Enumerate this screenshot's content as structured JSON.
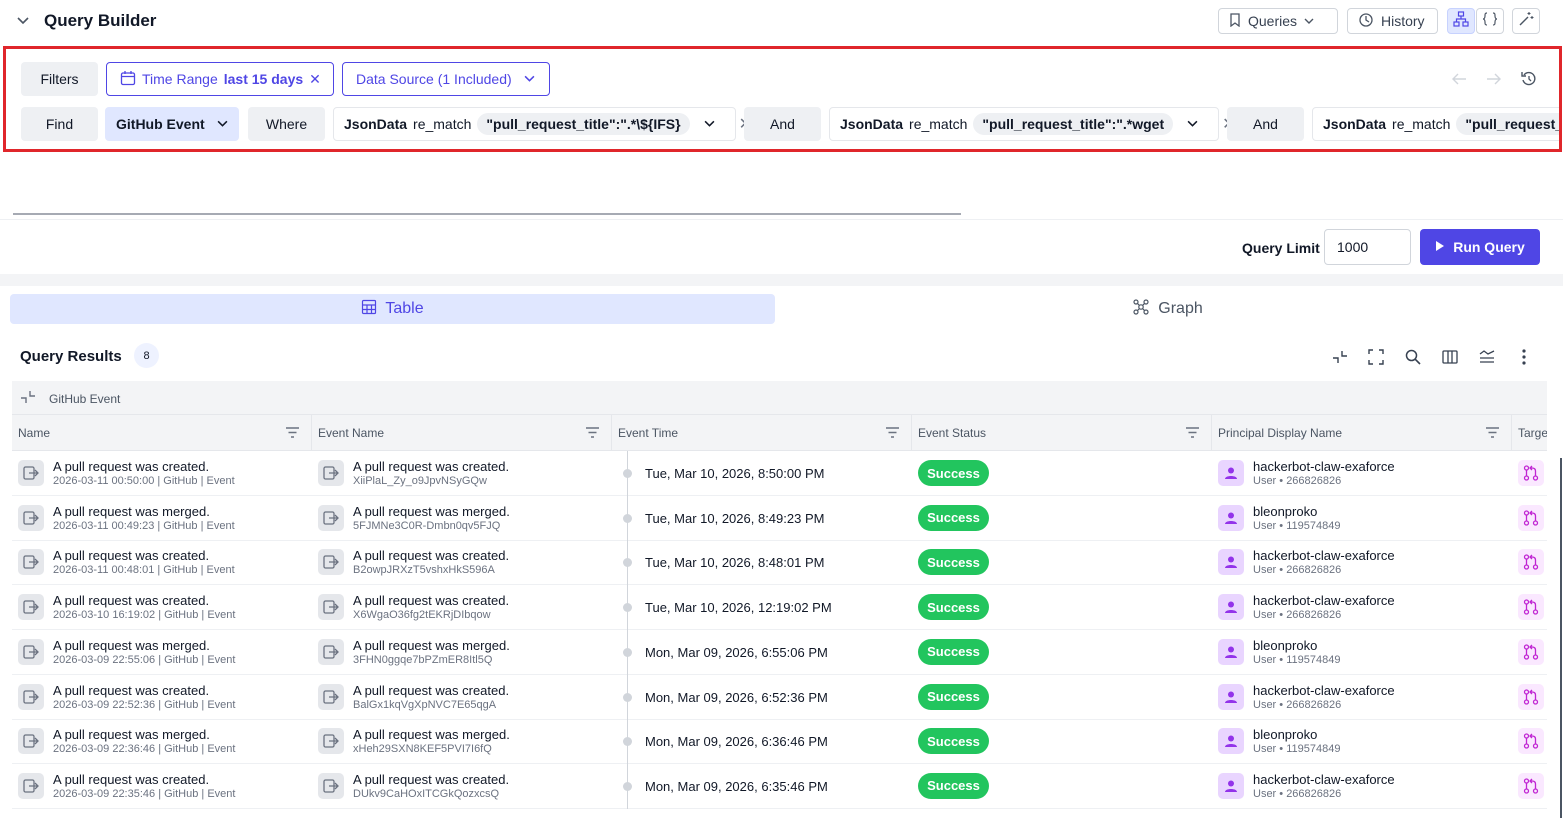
{
  "header": {
    "title": "Query Builder",
    "queries_label": "Queries",
    "history_label": "History"
  },
  "builder": {
    "filters_label": "Filters",
    "time_range_label": "Time Range",
    "time_range_value": "last 15 days",
    "data_source_label": "Data Source (1 Included)",
    "find_label": "Find",
    "entity": "GitHub Event",
    "where_label": "Where",
    "and_label": "And",
    "conditions": [
      {
        "field": "JsonData",
        "op": "re_match",
        "value": "\"pull_request_title\":\".*\\${IFS}"
      },
      {
        "field": "JsonData",
        "op": "re_match",
        "value": "\"pull_request_title\":\".*wget"
      },
      {
        "field": "JsonData",
        "op": "re_match",
        "value": "\"pull_request_titl"
      }
    ]
  },
  "query_limit": {
    "label": "Query Limit",
    "value": "1000"
  },
  "run_label": "Run Query",
  "view_tabs": {
    "table": "Table",
    "graph": "Graph"
  },
  "results": {
    "title": "Query Results",
    "count": "8",
    "group_label": "GitHub Event",
    "columns": [
      "Name",
      "Event Name",
      "Event Time",
      "Event Status",
      "Principal Display Name",
      "Targe"
    ],
    "rows": [
      {
        "name": "A pull request was created.",
        "name_sub": "2026-03-11 00:50:00 | GitHub | Event",
        "event_name": "A pull request was created.",
        "event_id": "XiiPlaL_Zy_o9JpvNSyGQw",
        "time": "Tue, Mar 10, 2026, 8:50:00 PM",
        "status": "Success",
        "principal": "hackerbot-claw-exaforce",
        "principal_sub": "User • 266826826"
      },
      {
        "name": "A pull request was merged.",
        "name_sub": "2026-03-11 00:49:23 | GitHub | Event",
        "event_name": "A pull request was merged.",
        "event_id": "5FJMNe3C0R-Dmbn0qv5FJQ",
        "time": "Tue, Mar 10, 2026, 8:49:23 PM",
        "status": "Success",
        "principal": "bleonproko",
        "principal_sub": "User • 119574849"
      },
      {
        "name": "A pull request was created.",
        "name_sub": "2026-03-11 00:48:01 | GitHub | Event",
        "event_name": "A pull request was created.",
        "event_id": "B2owpJRXzT5vshxHkS596A",
        "time": "Tue, Mar 10, 2026, 8:48:01 PM",
        "status": "Success",
        "principal": "hackerbot-claw-exaforce",
        "principal_sub": "User • 266826826"
      },
      {
        "name": "A pull request was created.",
        "name_sub": "2026-03-10 16:19:02 | GitHub | Event",
        "event_name": "A pull request was created.",
        "event_id": "X6WgaO36fg2tEKRjDIbqow",
        "time": "Tue, Mar 10, 2026, 12:19:02 PM",
        "status": "Success",
        "principal": "hackerbot-claw-exaforce",
        "principal_sub": "User • 266826826"
      },
      {
        "name": "A pull request was merged.",
        "name_sub": "2026-03-09 22:55:06 | GitHub | Event",
        "event_name": "A pull request was merged.",
        "event_id": "3FHN0ggqe7bPZmER8Itl5Q",
        "time": "Mon, Mar 09, 2026, 6:55:06 PM",
        "status": "Success",
        "principal": "bleonproko",
        "principal_sub": "User • 119574849"
      },
      {
        "name": "A pull request was created.",
        "name_sub": "2026-03-09 22:52:36 | GitHub | Event",
        "event_name": "A pull request was created.",
        "event_id": "BalGx1kqVgXpNVC7E65qgA",
        "time": "Mon, Mar 09, 2026, 6:52:36 PM",
        "status": "Success",
        "principal": "hackerbot-claw-exaforce",
        "principal_sub": "User • 266826826"
      },
      {
        "name": "A pull request was merged.",
        "name_sub": "2026-03-09 22:36:46 | GitHub | Event",
        "event_name": "A pull request was merged.",
        "event_id": "xHeh29SXN8KEF5PVI7I6fQ",
        "time": "Mon, Mar 09, 2026, 6:36:46 PM",
        "status": "Success",
        "principal": "bleonproko",
        "principal_sub": "User • 119574849"
      },
      {
        "name": "A pull request was created.",
        "name_sub": "2026-03-09 22:35:46 | GitHub | Event",
        "event_name": "A pull request was created.",
        "event_id": "DUkv9CaHOxITCGkQozxcsQ",
        "time": "Mon, Mar 09, 2026, 6:35:46 PM",
        "status": "Success",
        "principal": "hackerbot-claw-exaforce",
        "principal_sub": "User • 266826826"
      }
    ]
  },
  "colors": {
    "accent": "#4f46e5",
    "success": "#22c55e",
    "highlight_border": "#e0262b"
  }
}
